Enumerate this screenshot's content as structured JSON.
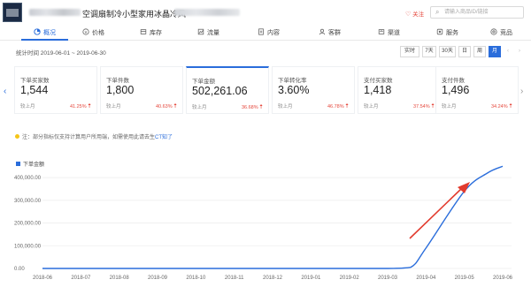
{
  "header": {
    "product_title": "空调扇制冷小型家用冰晶冷风",
    "follow_label": "关注",
    "search_placeholder": "请输入商品ID/链接"
  },
  "tabs": [
    {
      "label": "概况",
      "active": true
    },
    {
      "label": "价格"
    },
    {
      "label": "库存"
    },
    {
      "label": "流量"
    },
    {
      "label": "内容"
    },
    {
      "label": "客群"
    },
    {
      "label": "渠道"
    },
    {
      "label": "服务"
    },
    {
      "label": "竞品"
    }
  ],
  "date_range": "统计时间 2019-06-01 ~ 2019-06-30",
  "period_buttons": [
    "实时",
    "7天",
    "30天",
    "日",
    "周",
    "月"
  ],
  "active_period": "月",
  "metrics": [
    {
      "label": "下单买家数",
      "value": "1,544",
      "compare": "较上月",
      "change": "41.25%"
    },
    {
      "label": "下单件数",
      "value": "1,800",
      "compare": "较上月",
      "change": "40.63%"
    },
    {
      "label": "下单金额",
      "value": "502,261.06",
      "compare": "较上月",
      "change": "36.68%",
      "active": true
    },
    {
      "label": "下单转化率",
      "value": "3.60%",
      "compare": "较上月",
      "change": "46.78%"
    },
    {
      "label": "支付买家数",
      "value": "1,418",
      "compare": "较上月",
      "change": "37.54%"
    },
    {
      "label": "支付件数",
      "value": "1,496",
      "compare": "较上月",
      "change": "34.24%"
    }
  ],
  "notice": {
    "text": "注：部分指标仅支持计算用户所用端，如需使用此请去生",
    "link": "CT知了"
  },
  "colors": {
    "accent": "#2a6ddb",
    "up": "#e5483d",
    "annotation_arrow": "#e23b2e"
  },
  "chart_data": {
    "type": "line",
    "series": [
      {
        "name": "下单金额",
        "values": [
          0,
          0,
          0,
          0,
          0,
          0,
          0,
          0,
          0,
          0,
          5000,
          90000,
          340000,
          420000,
          450000
        ]
      }
    ],
    "x": [
      "2018-06",
      "2018-07",
      "2018-08",
      "2018-09",
      "2018-10",
      "2018-11",
      "2018-12",
      "2019-01",
      "2019-02",
      "2019-03",
      "2019-04",
      "2019-05",
      "2019-06"
    ],
    "x_points": [
      0,
      1,
      2,
      3,
      4,
      5,
      6,
      7,
      8,
      9,
      9.6,
      10,
      11,
      11.6,
      12
    ],
    "yticks": [
      "0.00",
      "100,000.00",
      "200,000.00",
      "300,000.00",
      "400,000.00"
    ],
    "ylim": [
      0,
      420000
    ],
    "grid": true,
    "legend": "top-left"
  }
}
